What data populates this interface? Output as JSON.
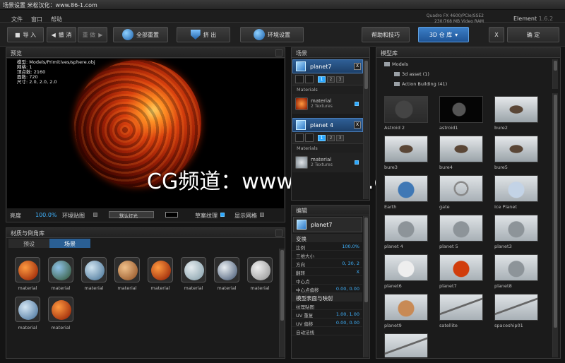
{
  "window": {
    "title": "场景设置 米松汉化：www.86-1.com"
  },
  "menu": [
    "文件",
    "窗口",
    "帮助"
  ],
  "gpu": {
    "line1": "Quadro FX 4600/PCIe/SSE2",
    "line2": "230/768 MB Video RAM"
  },
  "element": {
    "name": "Element",
    "version": "1.6.2"
  },
  "toolbar": {
    "import": "导 入",
    "undo": "撤 消",
    "redo": "重 做",
    "reset_all": "全部重置",
    "extrude": "挤 出",
    "env": "环境设置",
    "help": "帮助和技巧",
    "warehouse": "3D 仓 库",
    "close": "X",
    "ok": "确 定"
  },
  "preview": {
    "title": "预览",
    "stats": [
      "模型: Models/Primitives/sphere.obj",
      "网格: 1",
      "顶点数: 2160",
      "面数: 720",
      "尺寸: 2.0, 2.0, 2.0"
    ],
    "watermark": "CG频道：www.cgown.com",
    "brightness_label": "亮度",
    "brightness_value": "100.0%",
    "env_map_label": "环境贴图",
    "light_value": "默认灯光",
    "draft_label": "草案纹理",
    "grid_label": "显示网格"
  },
  "library": {
    "title": "材质与倒角库",
    "tabs": [
      "预设",
      "场景"
    ],
    "items": [
      {
        "label": "material",
        "c1": "#ff9a40",
        "c2": "#8a1500"
      },
      {
        "label": "material",
        "c1": "#8fc2e8",
        "c2": "#2b4f2a"
      },
      {
        "label": "material",
        "c1": "#d0e4f0",
        "c2": "#3e6c92"
      },
      {
        "label": "material",
        "c1": "#f0c08a",
        "c2": "#8a4a1e"
      },
      {
        "label": "material",
        "c1": "#ff9a40",
        "c2": "#8a1500"
      },
      {
        "label": "material",
        "c1": "#e5ecef",
        "c2": "#7f9aa6"
      },
      {
        "label": "material",
        "c1": "#e9eef2",
        "c2": "#3b4f6c"
      },
      {
        "label": "material",
        "c1": "#f0f0f0",
        "c2": "#8f8f8f"
      },
      {
        "label": "material",
        "c1": "#d4e6f4",
        "c2": "#3e6a95"
      },
      {
        "label": "material",
        "c1": "#ff9a40",
        "c2": "#8a1500"
      }
    ]
  },
  "scene": {
    "title": "场景",
    "objects": [
      {
        "name": "planet7",
        "mat": "material",
        "sub": "2 Textures",
        "mc1": "#ff9a40",
        "mc2": "#8a1500"
      },
      {
        "name": "planet 4",
        "mat": "material",
        "sub": "2 Textures",
        "mc1": "#e0e4e8",
        "mc2": "#7b858c"
      }
    ],
    "materials_label": "Materials",
    "close": "X",
    "nums": [
      "1",
      "2",
      "3"
    ]
  },
  "edit": {
    "title": "编辑",
    "object": "planet7",
    "transform": "变换",
    "rows": [
      {
        "k": "比例",
        "v": "100.0%"
      },
      {
        "k": "三维大小",
        "v": ""
      },
      {
        "k": "方向",
        "v": "0, 30, 2"
      },
      {
        "k": "翻转",
        "v": "X"
      },
      {
        "k": "中心点",
        "v": ""
      },
      {
        "k": "中心点偏移",
        "v": "0.00, 0.00"
      }
    ],
    "mapping": "模型表面与映射",
    "rows2": [
      {
        "k": "纹理贴图",
        "v": ""
      },
      {
        "k": "UV 重复",
        "v": "1.00, 1.00"
      },
      {
        "k": "UV 偏移",
        "v": "0.00, 0.00"
      },
      {
        "k": "自动法线",
        "v": ""
      }
    ]
  },
  "models": {
    "title": "模型库",
    "tree": [
      {
        "label": "Models",
        "level": 0
      },
      {
        "label": "3d asset (1)",
        "level": 1
      },
      {
        "label": "Action Building (41)",
        "level": 1
      }
    ],
    "items": [
      {
        "label": "Astroid 2",
        "kind": "rock"
      },
      {
        "label": "astroid1",
        "kind": "rockdark"
      },
      {
        "label": "bure2",
        "kind": "tower"
      },
      {
        "label": "bure3",
        "kind": "tower"
      },
      {
        "label": "bure4",
        "kind": "tower"
      },
      {
        "label": "bure5",
        "kind": "tower"
      },
      {
        "label": "Earth",
        "kind": "earth"
      },
      {
        "label": "gate",
        "kind": "ring"
      },
      {
        "label": "Ice Planet",
        "kind": "ice"
      },
      {
        "label": "planet 4",
        "kind": "grey"
      },
      {
        "label": "planet 5",
        "kind": "grey"
      },
      {
        "label": "planet3",
        "kind": "grey"
      },
      {
        "label": "planet6",
        "kind": "white"
      },
      {
        "label": "planet7",
        "kind": "fire"
      },
      {
        "label": "planet8",
        "kind": "grey"
      },
      {
        "label": "planet9",
        "kind": "jupiter"
      },
      {
        "label": "satellite",
        "kind": "ship"
      },
      {
        "label": "spaceship01",
        "kind": "ship"
      },
      {
        "label": "",
        "kind": "ship"
      }
    ]
  }
}
